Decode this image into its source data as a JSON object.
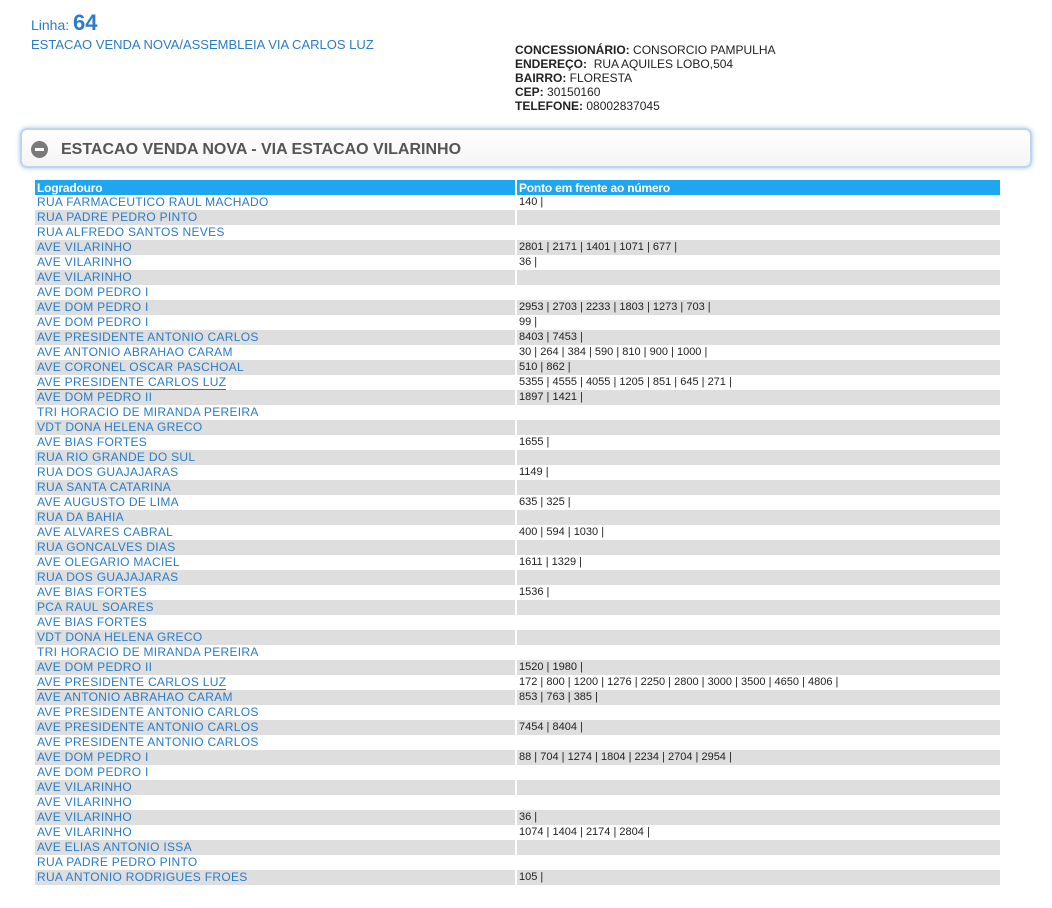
{
  "header": {
    "linha_label": "Linha:",
    "linha_number": "64",
    "route_name": "ESTACAO VENDA NOVA/ASSEMBLEIA VIA CARLOS LUZ"
  },
  "info": {
    "concessionario_label": "CONCESSIONÁRIO:",
    "concessionario_value": "CONSORCIO PAMPULHA",
    "endereco_label": "ENDEREÇO:",
    "endereco_value": "RUA AQUILES LOBO,504",
    "bairro_label": "BAIRRO:",
    "bairro_value": "FLORESTA",
    "cep_label": "CEP:",
    "cep_value": "30150160",
    "telefone_label": "TELEFONE:",
    "telefone_value": "08002837045"
  },
  "panel": {
    "title": "ESTACAO VENDA NOVA - VIA ESTACAO VILARINHO",
    "toggle_icon": "collapse-minus-icon"
  },
  "table": {
    "col1_header": "Logradouro",
    "col2_header": "Ponto em frente ao número",
    "rows": [
      {
        "street": "RUA FARMACEUTICO RAUL MACHADO",
        "numbers": [
          "140"
        ]
      },
      {
        "street": "RUA PADRE PEDRO PINTO",
        "numbers": []
      },
      {
        "street": "RUA ALFREDO SANTOS NEVES",
        "numbers": []
      },
      {
        "street": "AVE VILARINHO",
        "numbers": [
          "2801",
          "2171",
          "1401",
          "1071",
          "677"
        ]
      },
      {
        "street": "AVE VILARINHO",
        "numbers": [
          "36"
        ]
      },
      {
        "street": "AVE VILARINHO",
        "numbers": []
      },
      {
        "street": "AVE DOM PEDRO I",
        "numbers": []
      },
      {
        "street": "AVE DOM PEDRO I",
        "numbers": [
          "2953",
          "2703",
          "2233",
          "1803",
          "1273",
          "703"
        ]
      },
      {
        "street": "AVE DOM PEDRO I",
        "numbers": [
          "99"
        ]
      },
      {
        "street": "AVE PRESIDENTE ANTONIO CARLOS",
        "numbers": [
          "8403",
          "7453"
        ]
      },
      {
        "street": "AVE ANTONIO ABRAHAO CARAM",
        "numbers": [
          "30",
          "264",
          "384",
          "590",
          "810",
          "900",
          "1000"
        ]
      },
      {
        "street": "AVE CORONEL OSCAR PASCHOAL",
        "numbers": [
          "510",
          "862"
        ]
      },
      {
        "street": "AVE PRESIDENTE CARLOS LUZ",
        "numbers": [
          "5355",
          "4555",
          "4055",
          "1205",
          "851",
          "645",
          "271"
        ],
        "underline": true
      },
      {
        "street": "AVE DOM PEDRO II",
        "numbers": [
          "1897",
          "1421"
        ]
      },
      {
        "street": "TRI HORACIO DE MIRANDA PEREIRA",
        "numbers": []
      },
      {
        "street": "VDT DONA HELENA GRECO",
        "numbers": []
      },
      {
        "street": "AVE BIAS FORTES",
        "numbers": [
          "1655"
        ]
      },
      {
        "street": "RUA RIO GRANDE DO SUL",
        "numbers": []
      },
      {
        "street": "RUA DOS GUAJAJARAS",
        "numbers": [
          "1149"
        ]
      },
      {
        "street": "RUA SANTA CATARINA",
        "numbers": []
      },
      {
        "street": "AVE AUGUSTO DE LIMA",
        "numbers": [
          "635",
          "325"
        ]
      },
      {
        "street": "RUA DA BAHIA",
        "numbers": []
      },
      {
        "street": "AVE ALVARES CABRAL",
        "numbers": [
          "400",
          "594",
          "1030"
        ]
      },
      {
        "street": "RUA GONCALVES DIAS",
        "numbers": []
      },
      {
        "street": "AVE OLEGARIO MACIEL",
        "numbers": [
          "1611",
          "1329"
        ]
      },
      {
        "street": "RUA DOS GUAJAJARAS",
        "numbers": []
      },
      {
        "street": "AVE BIAS FORTES",
        "numbers": [
          "1536"
        ]
      },
      {
        "street": "PCA RAUL SOARES",
        "numbers": []
      },
      {
        "street": "AVE BIAS FORTES",
        "numbers": []
      },
      {
        "street": "VDT DONA HELENA GRECO",
        "numbers": []
      },
      {
        "street": "TRI HORACIO DE MIRANDA PEREIRA",
        "numbers": []
      },
      {
        "street": "AVE DOM PEDRO II",
        "numbers": [
          "1520",
          "1980"
        ]
      },
      {
        "street": "AVE PRESIDENTE CARLOS LUZ",
        "numbers": [
          "172",
          "800",
          "1200",
          "1276",
          "2250",
          "2800",
          "3000",
          "3500",
          "4650",
          "4806"
        ],
        "underline": true
      },
      {
        "street": "AVE ANTONIO ABRAHAO CARAM",
        "numbers": [
          "853",
          "763",
          "385"
        ]
      },
      {
        "street": "AVE PRESIDENTE ANTONIO CARLOS",
        "numbers": []
      },
      {
        "street": "AVE PRESIDENTE ANTONIO CARLOS",
        "numbers": [
          "7454",
          "8404"
        ]
      },
      {
        "street": "AVE PRESIDENTE ANTONIO CARLOS",
        "numbers": []
      },
      {
        "street": "AVE DOM PEDRO I",
        "numbers": [
          "88",
          "704",
          "1274",
          "1804",
          "2234",
          "2704",
          "2954"
        ]
      },
      {
        "street": "AVE DOM PEDRO I",
        "numbers": []
      },
      {
        "street": "AVE VILARINHO",
        "numbers": []
      },
      {
        "street": "AVE VILARINHO",
        "numbers": []
      },
      {
        "street": "AVE VILARINHO",
        "numbers": [
          "36"
        ]
      },
      {
        "street": "AVE VILARINHO",
        "numbers": [
          "1074",
          "1404",
          "2174",
          "2804"
        ]
      },
      {
        "street": "AVE ELIAS ANTONIO ISSA",
        "numbers": []
      },
      {
        "street": "RUA PADRE PEDRO PINTO",
        "numbers": []
      },
      {
        "street": "RUA ANTONIO RODRIGUES FROES",
        "numbers": [
          "105"
        ]
      }
    ]
  }
}
